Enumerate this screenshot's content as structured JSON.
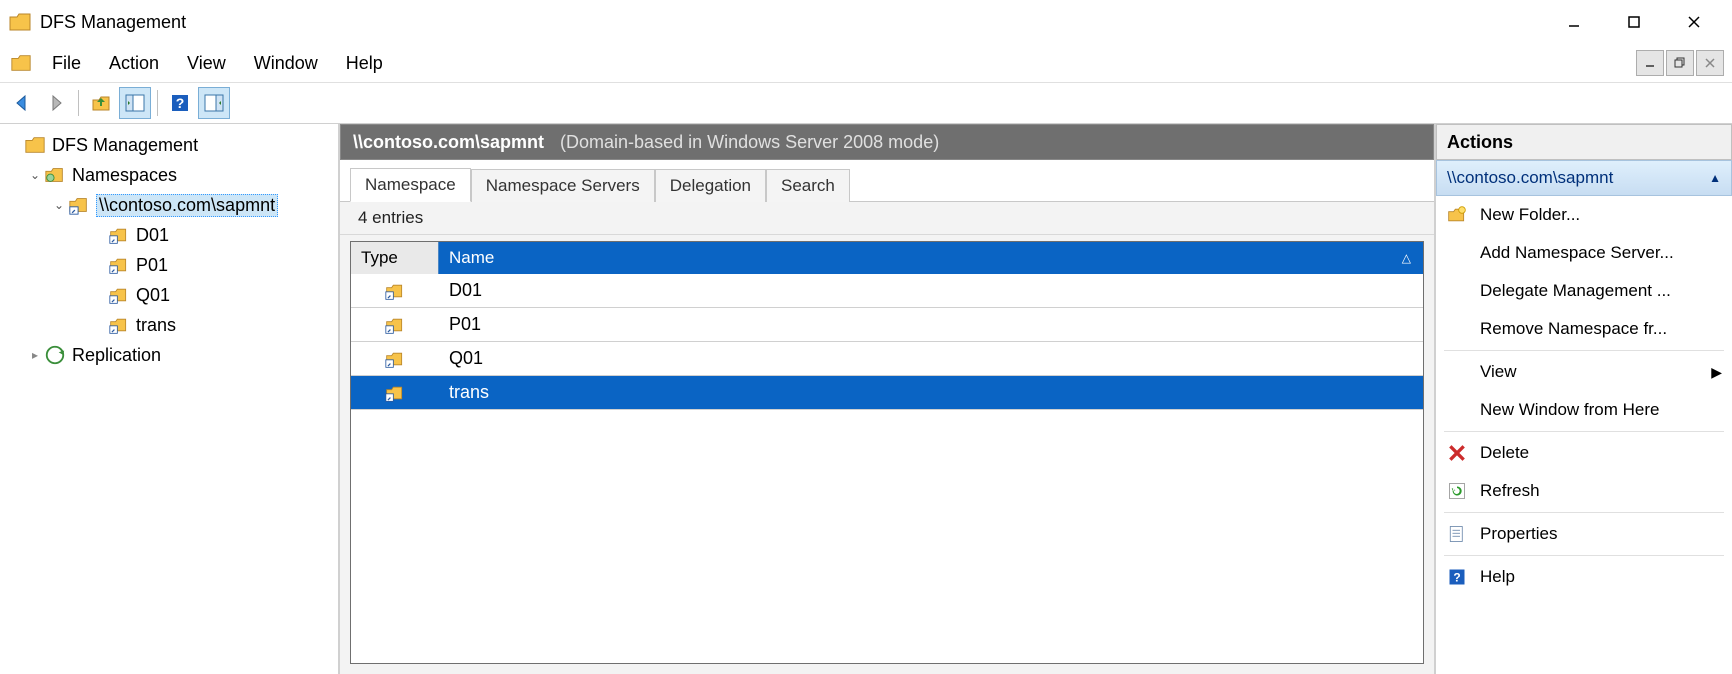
{
  "window": {
    "title": "DFS Management"
  },
  "menu": {
    "file": "File",
    "action": "Action",
    "view": "View",
    "window": "Window",
    "help": "Help"
  },
  "tree": {
    "root": "DFS Management",
    "namespaces": "Namespaces",
    "namespace_path": "\\\\contoso.com\\sapmnt",
    "children": [
      "D01",
      "P01",
      "Q01",
      "trans"
    ],
    "replication": "Replication"
  },
  "center": {
    "path": "\\\\contoso.com\\sapmnt",
    "mode": "(Domain-based in Windows Server 2008 mode)",
    "tabs": {
      "namespace": "Namespace",
      "servers": "Namespace Servers",
      "delegation": "Delegation",
      "search": "Search"
    },
    "entries_label": "4 entries",
    "columns": {
      "type": "Type",
      "name": "Name"
    },
    "rows": [
      {
        "name": "D01",
        "selected": false
      },
      {
        "name": "P01",
        "selected": false
      },
      {
        "name": "Q01",
        "selected": false
      },
      {
        "name": "trans",
        "selected": true
      }
    ]
  },
  "actions": {
    "title": "Actions",
    "context": "\\\\contoso.com\\sapmnt",
    "items": {
      "new_folder": "New Folder...",
      "add_server": "Add Namespace Server...",
      "delegate": "Delegate Management ...",
      "remove": "Remove Namespace fr...",
      "view": "View",
      "new_window": "New Window from Here",
      "delete": "Delete",
      "refresh": "Refresh",
      "properties": "Properties",
      "help": "Help"
    }
  }
}
